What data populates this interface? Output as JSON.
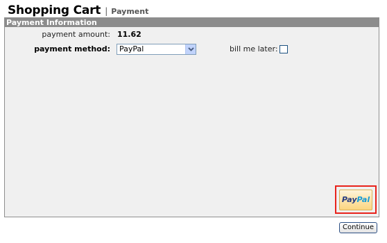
{
  "header": {
    "title": "Shopping Cart",
    "separator": "|",
    "section": "Payment"
  },
  "panel": {
    "title": "Payment Information",
    "payment_amount_label": "payment amount:",
    "payment_amount_value": "11.62",
    "payment_method_label": "payment method:",
    "payment_method_selected": "PayPal",
    "bill_me_later_label": "bill me later:",
    "bill_me_later_checked": false
  },
  "paypal_button": {
    "pay": "Pay",
    "pal": "Pal",
    "colors": {
      "pay": "#253b80",
      "pal": "#179bd7",
      "highlight_border": "#e8221b"
    }
  },
  "footer": {
    "continue_label": "Continue"
  },
  "colors": {
    "panel_header_bg": "#8c8c8c",
    "panel_bg": "#f0f0f0"
  }
}
